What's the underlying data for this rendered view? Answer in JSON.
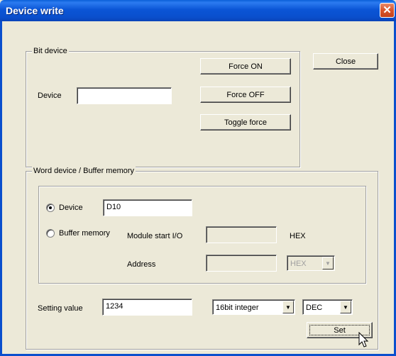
{
  "window": {
    "title": "Device write",
    "close_glyph": "✕"
  },
  "bit_device": {
    "label": "Bit device",
    "device_label": "Device",
    "device_value": "",
    "force_on": "Force ON",
    "force_off": "Force OFF",
    "toggle_force": "Toggle force"
  },
  "close_button": "Close",
  "word_device": {
    "label": "Word device / Buffer memory",
    "device_radio": "Device",
    "device_selected": true,
    "device_value": "D10",
    "buffer_radio": "Buffer memory",
    "module_start_label": "Module start I/O",
    "module_start_value": "",
    "hex_label": "HEX",
    "address_label": "Address",
    "address_value": "",
    "address_format": "HEX"
  },
  "setting": {
    "label": "Setting value",
    "value": "1234",
    "type": "16bit integer",
    "format": "DEC",
    "set_button": "Set"
  },
  "icons": {
    "dropdown": "dropdown-arrow-icon",
    "cursor": "mouse-pointer-icon"
  }
}
